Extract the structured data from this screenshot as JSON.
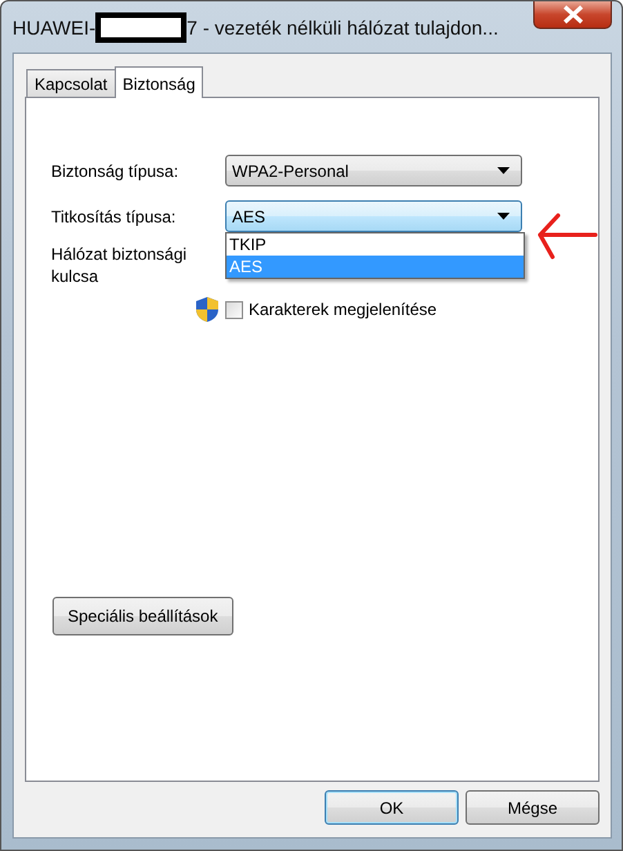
{
  "window": {
    "title_start": "HUAWEI-",
    "title_end": "7 - vezeték nélküli hálózat tulajdon...",
    "redacted": true
  },
  "tabs": [
    {
      "label": "Kapcsolat",
      "selected": false
    },
    {
      "label": "Biztonság",
      "selected": true
    }
  ],
  "fields": [
    {
      "kind": "combo",
      "label": "Biztonság típusa:",
      "value": "WPA2-Personal",
      "focused": false
    },
    {
      "kind": "combo",
      "label": "Titkosítás típusa:",
      "value": "AES",
      "focused": true,
      "options": [
        {
          "label": "TKIP",
          "selected": false
        },
        {
          "label": "AES",
          "selected": true
        }
      ]
    },
    {
      "kind": "text",
      "label": "Hálózat biztonsági kulcsa"
    }
  ],
  "show_characters": {
    "label": "Karakterek megjelenítése",
    "checked": false
  },
  "advanced_button": "Speciális beállítások",
  "annotation": {
    "kind": "arrow"
  },
  "buttons": [
    {
      "label": "OK",
      "default": true
    },
    {
      "label": "Mégse",
      "default": false
    }
  ]
}
